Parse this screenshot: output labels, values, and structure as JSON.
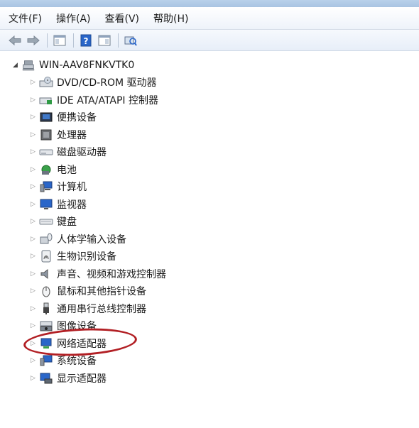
{
  "menu": [
    "文件(F)",
    "操作(A)",
    "查看(V)",
    "帮助(H)"
  ],
  "toolbar": {
    "icons": [
      "back-arrow-icon",
      "forward-arrow-icon",
      "properties-view-icon",
      "help-icon",
      "console-tree-icon",
      "scan-hardware-icon"
    ]
  },
  "tree": {
    "root": "WIN-AAV8FNKVTK0",
    "nodes": [
      {
        "label": "DVD/CD-ROM 驱动器",
        "icon": "dvd-drive-icon"
      },
      {
        "label": "IDE ATA/ATAPI 控制器",
        "icon": "ide-controller-icon"
      },
      {
        "label": "便携设备",
        "icon": "portable-device-icon"
      },
      {
        "label": "处理器",
        "icon": "processor-icon"
      },
      {
        "label": "磁盘驱动器",
        "icon": "disk-drive-icon"
      },
      {
        "label": "电池",
        "icon": "battery-icon"
      },
      {
        "label": "计算机",
        "icon": "computer-icon"
      },
      {
        "label": "监视器",
        "icon": "monitor-icon"
      },
      {
        "label": "键盘",
        "icon": "keyboard-icon"
      },
      {
        "label": "人体学输入设备",
        "icon": "hid-icon"
      },
      {
        "label": "生物识别设备",
        "icon": "biometric-icon"
      },
      {
        "label": "声音、视频和游戏控制器",
        "icon": "sound-icon"
      },
      {
        "label": "鼠标和其他指针设备",
        "icon": "mouse-icon"
      },
      {
        "label": "通用串行总线控制器",
        "icon": "usb-icon"
      },
      {
        "label": "图像设备",
        "icon": "imaging-device-icon"
      },
      {
        "label": "网络适配器",
        "icon": "network-adapter-icon"
      },
      {
        "label": "系统设备",
        "icon": "system-device-icon"
      },
      {
        "label": "显示适配器",
        "icon": "display-adapter-icon"
      }
    ]
  },
  "colors": {
    "highlight": "#b21f24",
    "accent": "#2a66c9"
  }
}
